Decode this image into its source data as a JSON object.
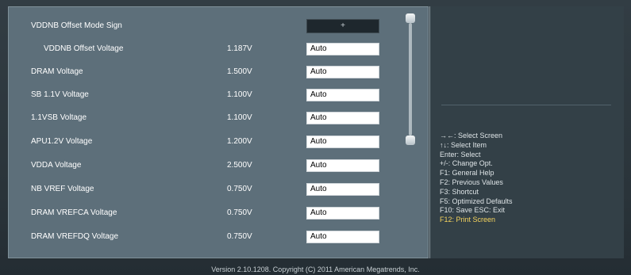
{
  "window": {
    "version": "Version 2.10.1208. Copyright (C) 2011 American Megatrends, Inc."
  },
  "main": {
    "sign": {
      "label": "VDDNB Offset Mode Sign",
      "value": "+"
    },
    "rows": [
      {
        "label": "VDDNB Offset Voltage",
        "current": "1.187V",
        "value": "Auto"
      },
      {
        "label": "DRAM Voltage",
        "current": "1.500V",
        "value": "Auto"
      },
      {
        "label": "SB 1.1V Voltage",
        "current": "1.100V",
        "value": "Auto"
      },
      {
        "label": "1.1VSB Voltage",
        "current": "1.100V",
        "value": "Auto"
      },
      {
        "label": "APU1.2V Voltage",
        "current": "1.200V",
        "value": "Auto"
      },
      {
        "label": "VDDA Voltage",
        "current": "2.500V",
        "value": "Auto"
      },
      {
        "label": "NB VREF Voltage",
        "current": "0.750V",
        "value": "Auto"
      },
      {
        "label": "DRAM VREFCA Voltage",
        "current": "0.750V",
        "value": "Auto"
      },
      {
        "label": "DRAM VREFDQ Voltage",
        "current": "0.750V",
        "value": "Auto"
      }
    ]
  },
  "help": {
    "items": [
      "→←: Select Screen",
      "↑↓: Select Item",
      "Enter: Select",
      "+/-: Change Opt.",
      "F1: General Help",
      "F2: Previous Values",
      "F3: Shortcut",
      "F5: Optimized Defaults",
      "F10: Save   ESC: Exit",
      "F12: Print Screen"
    ]
  },
  "colors": {
    "panel_background": "#5d6f7a",
    "right_panel_background": "#334047",
    "text_primary": "#ffffff",
    "help_highlight": "#f4d35e"
  },
  "icons": {
    "scroll_up": "scroll-thumb-top-icon",
    "scroll_down": "scroll-thumb-bottom-icon"
  }
}
